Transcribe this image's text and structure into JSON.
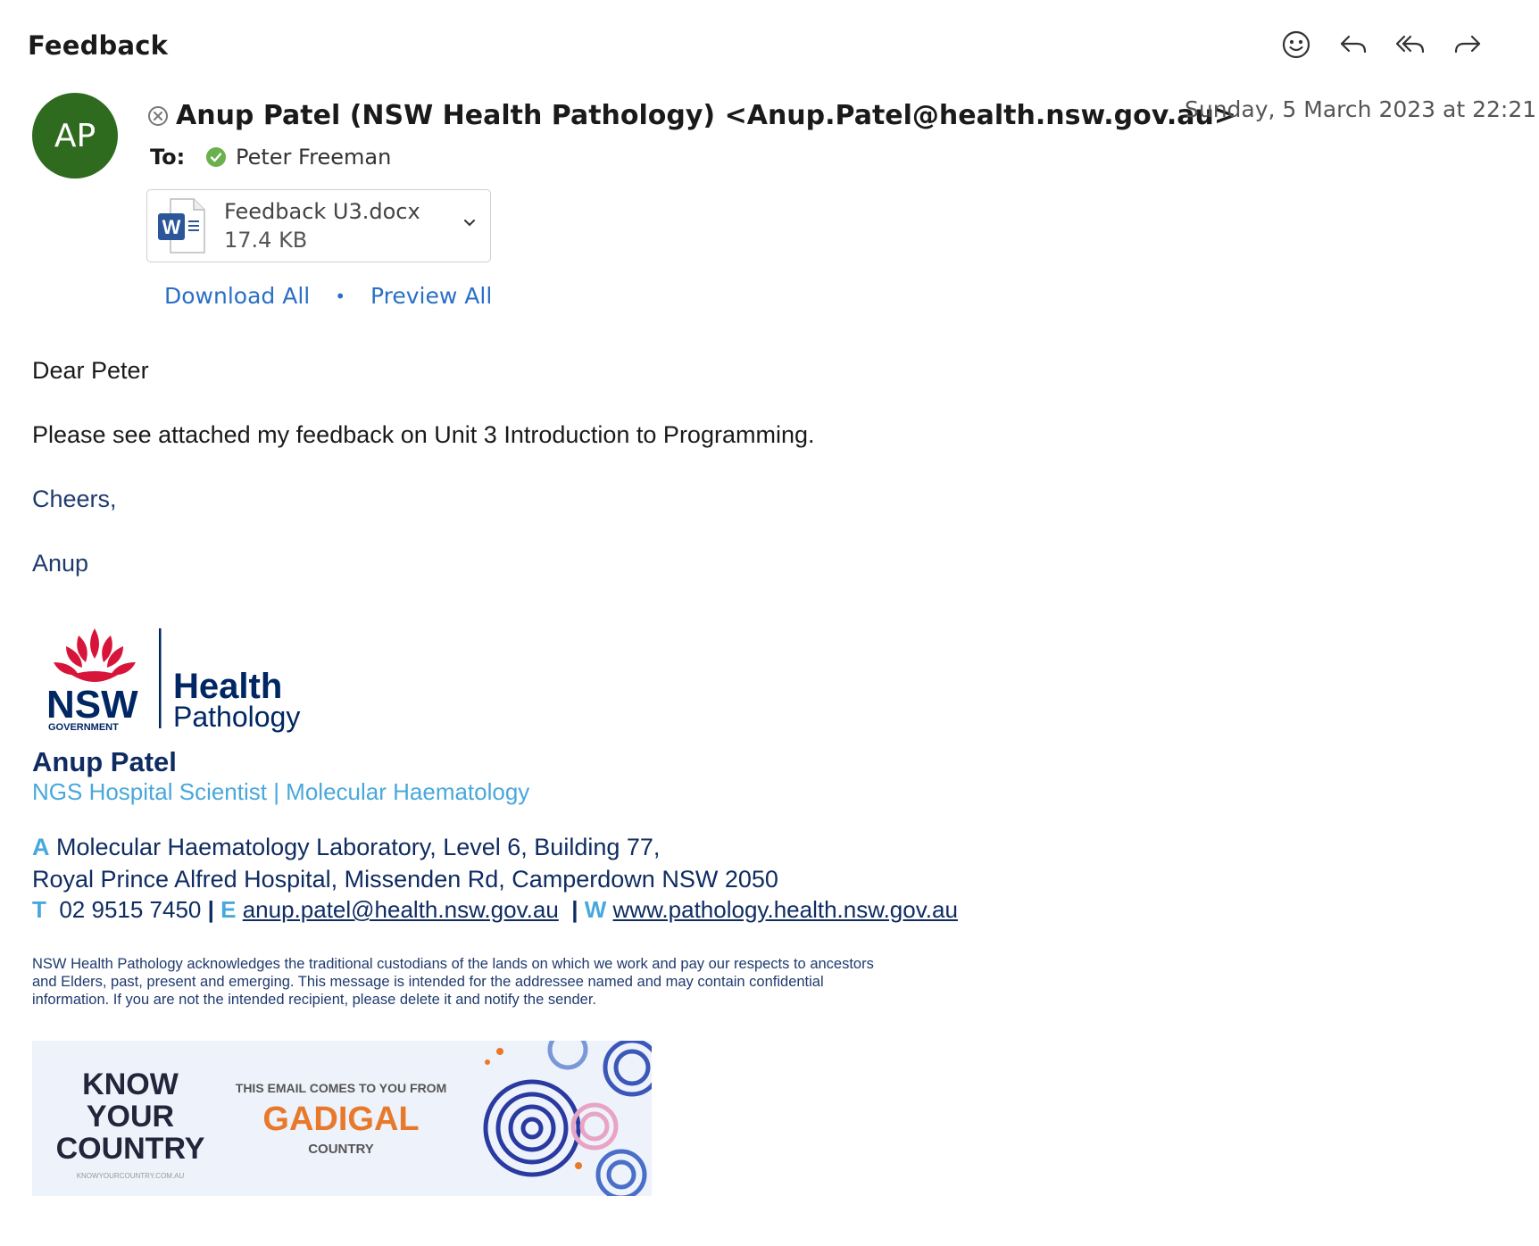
{
  "header": {
    "subject": "Feedback",
    "toolbar": [
      {
        "icon": "emoji-icon",
        "label": "React"
      },
      {
        "icon": "reply-icon",
        "label": "Reply"
      },
      {
        "icon": "reply-all-icon",
        "label": "Reply All"
      },
      {
        "icon": "forward-icon",
        "label": "Forward"
      }
    ]
  },
  "message": {
    "avatar_initials": "AP",
    "avatar_color": "#2e6b1f",
    "from": "Anup Patel (NSW Health Pathology) <Anup.Patel@health.nsw.gov.au>",
    "date": "Sunday, 5 March 2023 at 22:21",
    "to_label": "To:",
    "to_name": "Peter Freeman",
    "attachment": {
      "name": "Feedback U3.docx",
      "size": "17.4 KB",
      "icon": "word-doc-icon"
    },
    "download_all": "Download All",
    "separator": "•",
    "preview_all": "Preview All"
  },
  "body": {
    "greeting": "Dear Peter",
    "paragraph": "Please see attached my feedback on Unit 3 Introduction to Programming.",
    "closing": "Cheers,",
    "sign_name": "Anup"
  },
  "signature": {
    "logo": {
      "nsw": "NSW",
      "government": "GOVERNMENT",
      "health": "Health",
      "pathology": "Pathology"
    },
    "name": "Anup Patel",
    "role": "NGS Hospital Scientist | Molecular Haematology",
    "address_label": "A",
    "address_line1": "Molecular Haematology Laboratory, Level 6, Building 77,",
    "address_line2": "Royal Prince Alfred Hospital, Missenden Rd, Camperdown NSW 2050",
    "phone_label": "T",
    "phone": "02 9515 7450",
    "email_label": "E",
    "email": "anup.patel@health.nsw.gov.au",
    "web_label": "W",
    "web": "www.pathology.health.nsw.gov.au",
    "divider": "|",
    "disclaimer": "NSW Health Pathology acknowledges the traditional custodians of the lands on which we work and pay our respects to ancestors and Elders, past, present and emerging. This message is intended for the addressee named and may contain confidential information. If you are not the intended recipient, please delete it and notify the sender."
  },
  "banner": {
    "know": "KNOW",
    "your": "YOUR",
    "country": "COUNTRY",
    "site": "KNOWYOURCOUNTRY.COM.AU",
    "line1": "THIS EMAIL COMES TO YOU FROM",
    "line2": "GADIGAL",
    "line3": "COUNTRY"
  }
}
